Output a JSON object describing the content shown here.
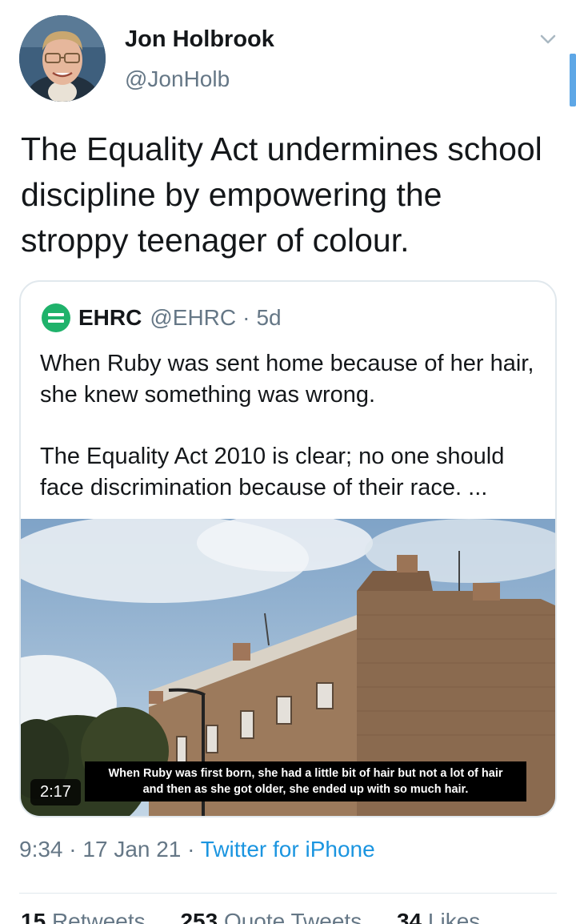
{
  "author": {
    "name": "Jon Holbrook",
    "handle": "@JonHolb"
  },
  "tweet": {
    "text": "The Equality Act undermines school discipline by empowering the stroppy teenager of colour."
  },
  "quote": {
    "name": "EHRC",
    "handle": "@EHRC",
    "separator": "·",
    "time": "5d",
    "paragraph1": "When Ruby was sent home because of her hair, she knew something was wrong.",
    "paragraph2": "The Equality Act 2010 is clear; no one should face discrimination because of their race. ...",
    "video": {
      "caption_line1": "When Ruby was first born, she had a little bit of hair but not a lot of hair",
      "caption_line2": "and then as she got older, she ended up with so much hair.",
      "duration": "2:17"
    }
  },
  "meta": {
    "time": "9:34",
    "sep1": " · ",
    "date": "17 Jan 21",
    "sep2": " · ",
    "source": "Twitter for iPhone"
  },
  "stats": {
    "retweets_count": "15",
    "retweets_label": "Retweets",
    "quotes_count": "253",
    "quotes_label": "Quote Tweets",
    "likes_count": "34",
    "likes_label": "Likes"
  },
  "icons": {
    "menu": "chevron-down-icon",
    "quote_logo": "ehrc-logo-icon"
  },
  "colors": {
    "link": "#1b95e0",
    "secondary_text": "#657786",
    "border": "#e1e8ed",
    "ehrc_green": "#1fb26b"
  }
}
